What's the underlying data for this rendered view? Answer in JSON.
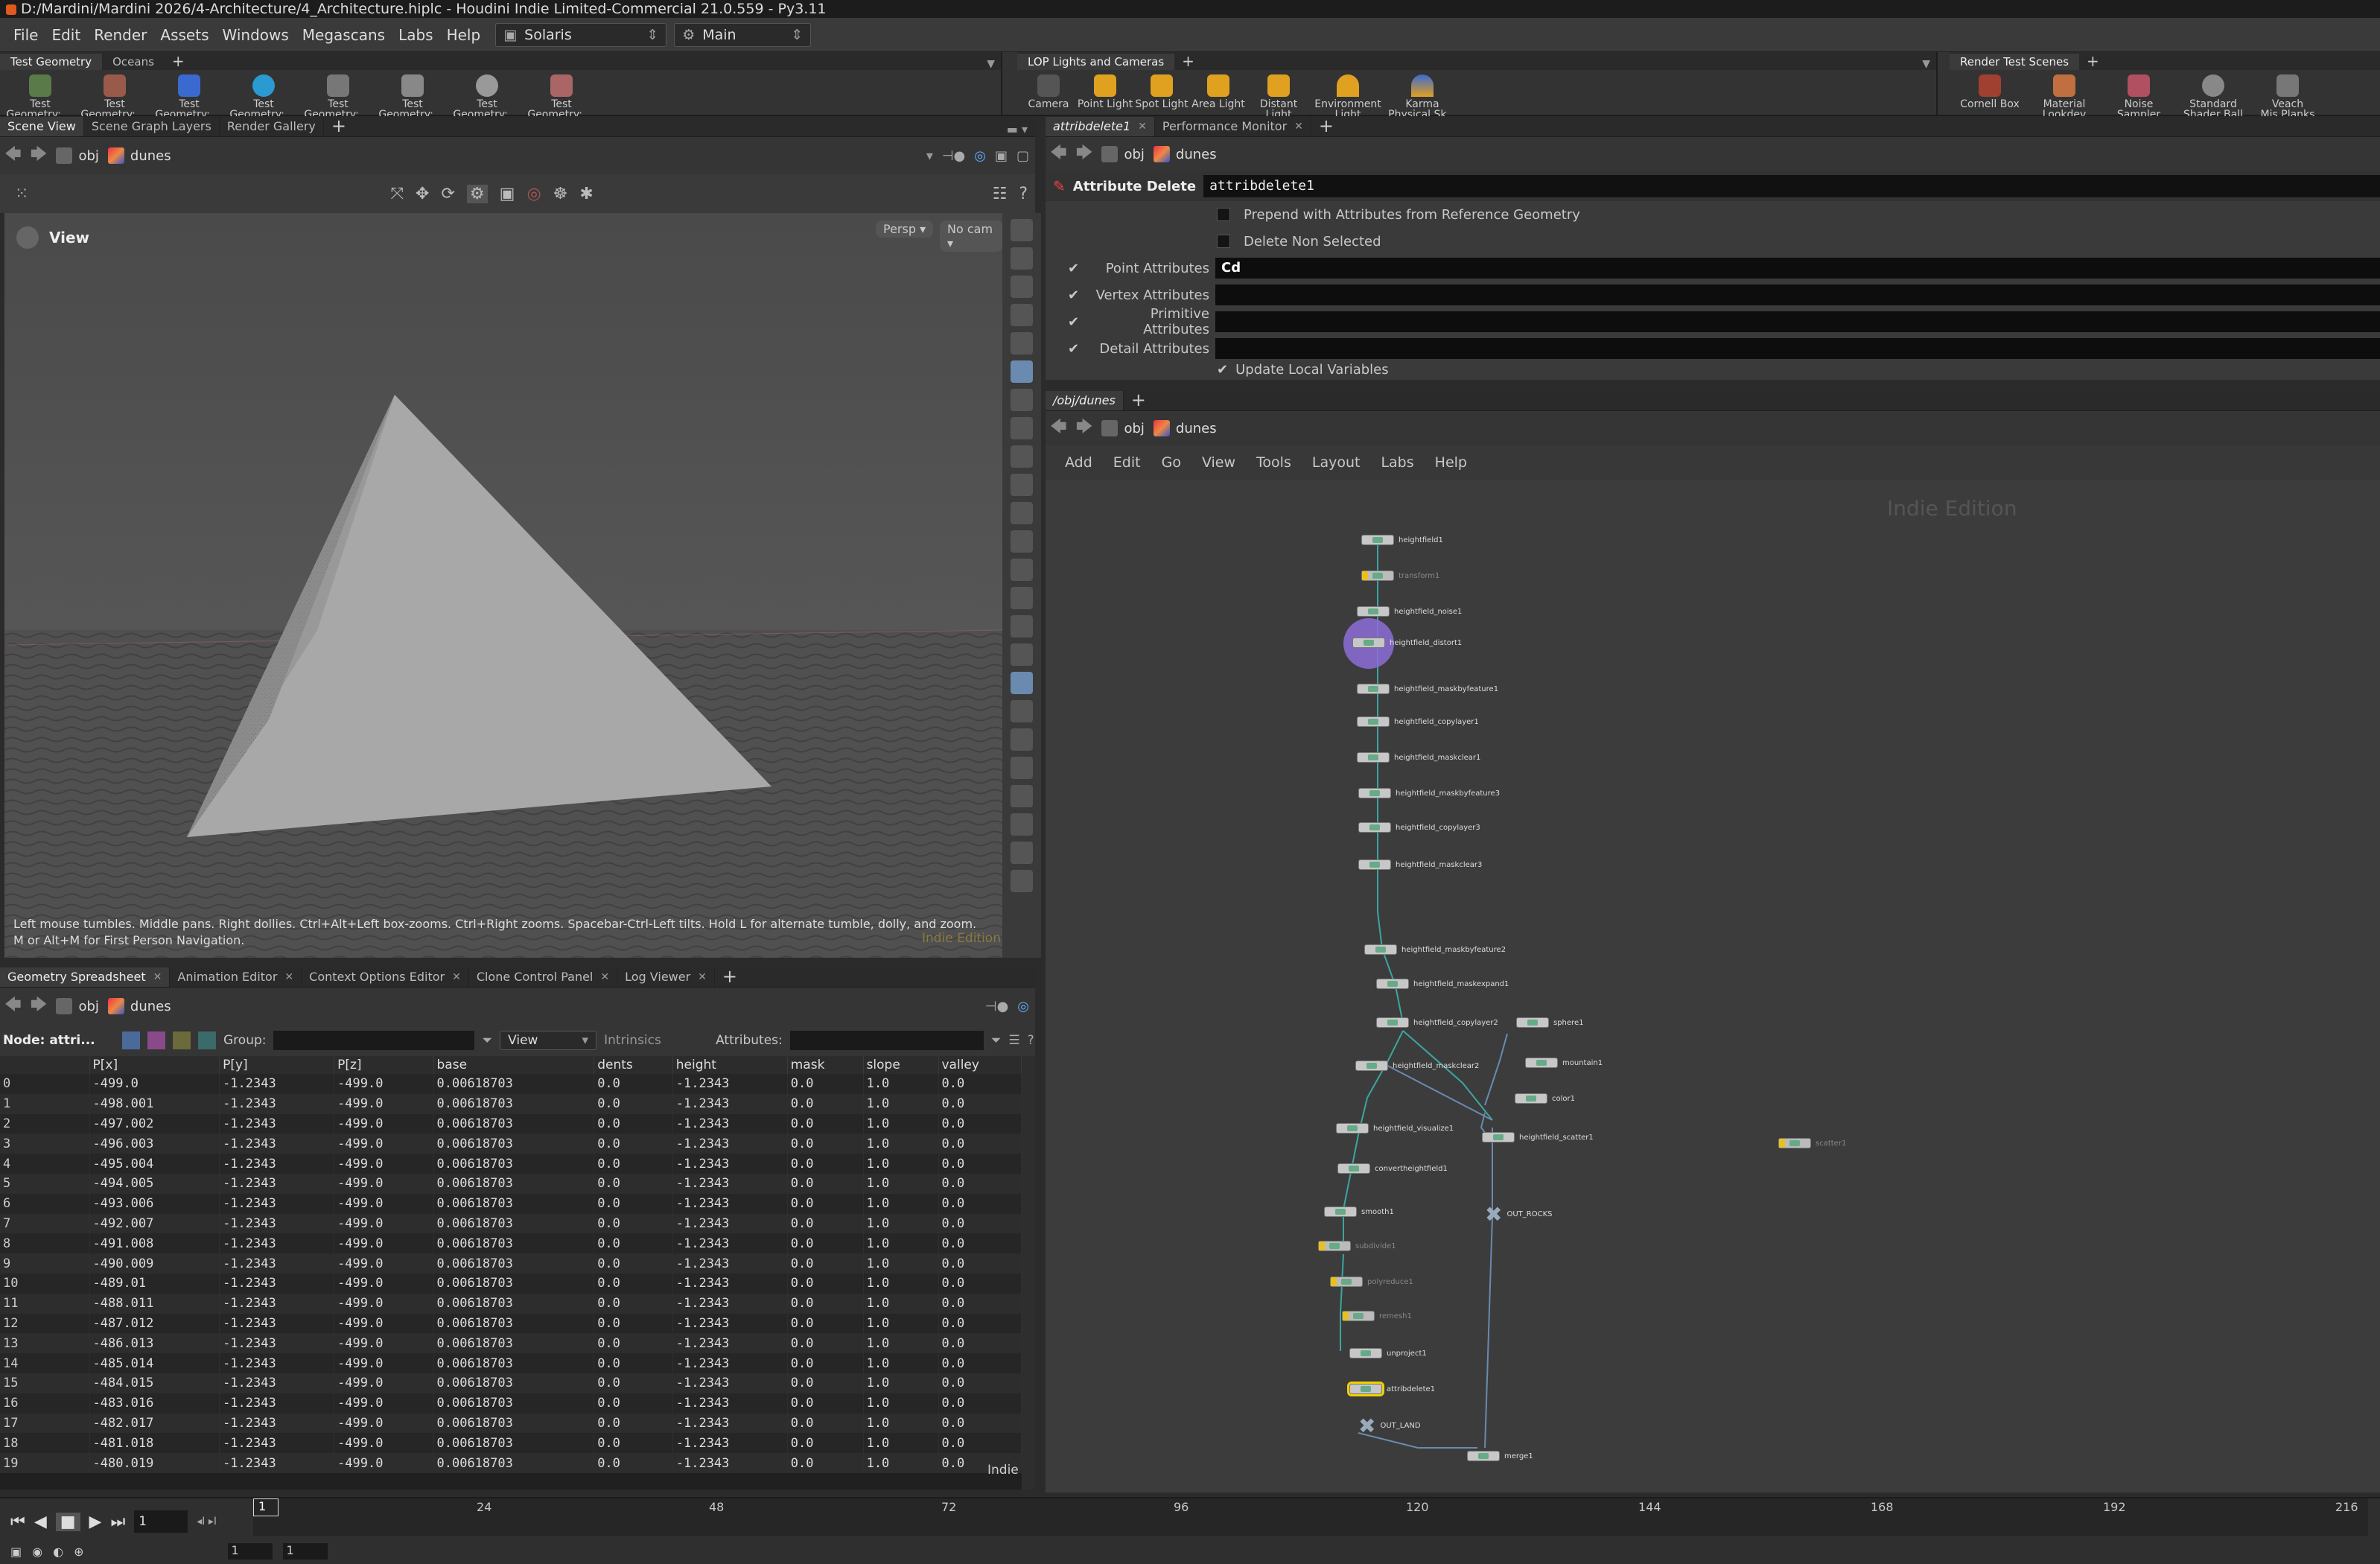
{
  "titlebar": {
    "title": "D:/Mardini/Mardini 2026/4-Architecture/4_Architecture.hiplc - Houdini Indie Limited-Commercial 21.0.559 - Py3.11"
  },
  "menu": {
    "items": [
      "File",
      "Edit",
      "Render",
      "Assets",
      "Windows",
      "Megascans",
      "Labs",
      "Help"
    ],
    "desktop": "Solaris",
    "context": "Main"
  },
  "shelves": {
    "set1": {
      "tabs": [
        "Test Geometry",
        "Oceans"
      ],
      "tools": [
        "Test Geometry: ...",
        "Test Geometry: ...",
        "Test Geometry: ...",
        "Test Geometry: ...",
        "Test Geometry: ...",
        "Test Geometry: ...",
        "Test Geometry: ...",
        "Test Geometry: ..."
      ]
    },
    "set2": {
      "tabs": [
        "LOP Lights and Cameras"
      ],
      "tools": [
        {
          "l1": "Camera",
          "l2": ""
        },
        {
          "l1": "Point Light",
          "l2": ""
        },
        {
          "l1": "Spot Light",
          "l2": ""
        },
        {
          "l1": "Area Light",
          "l2": ""
        },
        {
          "l1": "Distant Light",
          "l2": ""
        },
        {
          "l1": "Environment",
          "l2": "Light"
        },
        {
          "l1": "Karma",
          "l2": "Physical Sk..."
        }
      ]
    },
    "set3": {
      "tabs": [
        "Render Test Scenes"
      ],
      "tools": [
        {
          "l1": "Cornell Box",
          "l2": ""
        },
        {
          "l1": "Material",
          "l2": "Lookdev"
        },
        {
          "l1": "Noise",
          "l2": "Sampler"
        },
        {
          "l1": "Standard",
          "l2": "Shader Ball"
        },
        {
          "l1": "Veach",
          "l2": "Mis Planks"
        }
      ]
    }
  },
  "scene_pane": {
    "tabs": [
      "Scene View",
      "Scene Graph Layers",
      "Render Gallery"
    ],
    "path": {
      "obj": "obj",
      "node": "dunes"
    },
    "view_label": "View",
    "persp": "Persp ▾",
    "cam": "No cam ▾",
    "help": "Left mouse tumbles. Middle pans. Right dollies. Ctrl+Alt+Left box-zooms. Ctrl+Right zooms. Spacebar-Ctrl-Left tilts. Hold L for alternate tumble, dolly, and zoom. M or Alt+M for First Person Navigation.",
    "watermark": "Indie Edition"
  },
  "spreadsheet": {
    "tabs": [
      "Geometry Spreadsheet",
      "Animation Editor",
      "Context Options Editor",
      "Clone Control Panel",
      "Log Viewer"
    ],
    "path": {
      "obj": "obj",
      "node": "dunes"
    },
    "node_label": "Node: attri...",
    "group_label": "Group:",
    "view_label": "View",
    "intrinsics": "Intrinsics",
    "attributes_label": "Attributes:",
    "columns": [
      "",
      "P[x]",
      "P[y]",
      "P[z]",
      "base",
      "dents",
      "height",
      "mask",
      "slope",
      "valley"
    ],
    "rows": [
      [
        "0",
        "-499.0",
        "-1.2343",
        "-499.0",
        "0.00618703",
        "0.0",
        "-1.2343",
        "0.0",
        "1.0",
        "0.0"
      ],
      [
        "1",
        "-498.001",
        "-1.2343",
        "-499.0",
        "0.00618703",
        "0.0",
        "-1.2343",
        "0.0",
        "1.0",
        "0.0"
      ],
      [
        "2",
        "-497.002",
        "-1.2343",
        "-499.0",
        "0.00618703",
        "0.0",
        "-1.2343",
        "0.0",
        "1.0",
        "0.0"
      ],
      [
        "3",
        "-496.003",
        "-1.2343",
        "-499.0",
        "0.00618703",
        "0.0",
        "-1.2343",
        "0.0",
        "1.0",
        "0.0"
      ],
      [
        "4",
        "-495.004",
        "-1.2343",
        "-499.0",
        "0.00618703",
        "0.0",
        "-1.2343",
        "0.0",
        "1.0",
        "0.0"
      ],
      [
        "5",
        "-494.005",
        "-1.2343",
        "-499.0",
        "0.00618703",
        "0.0",
        "-1.2343",
        "0.0",
        "1.0",
        "0.0"
      ],
      [
        "6",
        "-493.006",
        "-1.2343",
        "-499.0",
        "0.00618703",
        "0.0",
        "-1.2343",
        "0.0",
        "1.0",
        "0.0"
      ],
      [
        "7",
        "-492.007",
        "-1.2343",
        "-499.0",
        "0.00618703",
        "0.0",
        "-1.2343",
        "0.0",
        "1.0",
        "0.0"
      ],
      [
        "8",
        "-491.008",
        "-1.2343",
        "-499.0",
        "0.00618703",
        "0.0",
        "-1.2343",
        "0.0",
        "1.0",
        "0.0"
      ],
      [
        "9",
        "-490.009",
        "-1.2343",
        "-499.0",
        "0.00618703",
        "0.0",
        "-1.2343",
        "0.0",
        "1.0",
        "0.0"
      ],
      [
        "10",
        "-489.01",
        "-1.2343",
        "-499.0",
        "0.00618703",
        "0.0",
        "-1.2343",
        "0.0",
        "1.0",
        "0.0"
      ],
      [
        "11",
        "-488.011",
        "-1.2343",
        "-499.0",
        "0.00618703",
        "0.0",
        "-1.2343",
        "0.0",
        "1.0",
        "0.0"
      ],
      [
        "12",
        "-487.012",
        "-1.2343",
        "-499.0",
        "0.00618703",
        "0.0",
        "-1.2343",
        "0.0",
        "1.0",
        "0.0"
      ],
      [
        "13",
        "-486.013",
        "-1.2343",
        "-499.0",
        "0.00618703",
        "0.0",
        "-1.2343",
        "0.0",
        "1.0",
        "0.0"
      ],
      [
        "14",
        "-485.014",
        "-1.2343",
        "-499.0",
        "0.00618703",
        "0.0",
        "-1.2343",
        "0.0",
        "1.0",
        "0.0"
      ],
      [
        "15",
        "-484.015",
        "-1.2343",
        "-499.0",
        "0.00618703",
        "0.0",
        "-1.2343",
        "0.0",
        "1.0",
        "0.0"
      ],
      [
        "16",
        "-483.016",
        "-1.2343",
        "-499.0",
        "0.00618703",
        "0.0",
        "-1.2343",
        "0.0",
        "1.0",
        "0.0"
      ],
      [
        "17",
        "-482.017",
        "-1.2343",
        "-499.0",
        "0.00618703",
        "0.0",
        "-1.2343",
        "0.0",
        "1.0",
        "0.0"
      ],
      [
        "18",
        "-481.018",
        "-1.2343",
        "-499.0",
        "0.00618703",
        "0.0",
        "-1.2343",
        "0.0",
        "1.0",
        "0.0"
      ],
      [
        "19",
        "-480.019",
        "-1.2343",
        "-499.0",
        "0.00618703",
        "0.0",
        "-1.2343",
        "0.0",
        "1.0",
        "0.0"
      ]
    ],
    "indie": "Indie"
  },
  "params_pane": {
    "tabs": [
      "attribdelete1",
      "Performance Monitor"
    ],
    "path": {
      "obj": "obj",
      "node": "dunes"
    },
    "node_type": "Attribute Delete",
    "node_name": "attribdelete1",
    "prepend": "Prepend with Attributes from Reference Geometry",
    "delete_non_selected": "Delete Non Selected",
    "fields": [
      {
        "label": "Point Attributes",
        "value": "Cd"
      },
      {
        "label": "Vertex Attributes",
        "value": ""
      },
      {
        "label": "Primitive Attributes",
        "value": ""
      },
      {
        "label": "Detail Attributes",
        "value": ""
      }
    ],
    "update_local": "Update Local Variables"
  },
  "network_pane": {
    "tabs": [
      "/obj/dunes"
    ],
    "path": {
      "obj": "obj",
      "node": "dunes"
    },
    "menu": [
      "Add",
      "Edit",
      "Go",
      "View",
      "Tools",
      "Layout",
      "Labs",
      "Help"
    ],
    "watermark": "Indie Edition",
    "nodes": [
      "heightfield1",
      "transform1",
      "heightfield_noise1",
      "heightfield_distort1",
      "heightfield_maskbyfeature1",
      "heightfield_copylayer1",
      "heightfield_maskclear1",
      "heightfield_maskbyfeature3",
      "heightfield_copylayer3",
      "heightfield_maskclear3",
      "heightfield_maskbyfeature2",
      "heightfield_maskexpand1",
      "heightfield_copylayer2",
      "sphere1",
      "mountain1",
      "heightfield_maskclear2",
      "color1",
      "heightfield_visualize1",
      "heightfield_scatter1",
      "convertheightfield1",
      "OUT_ROCKS",
      "smooth1",
      "subdivide1",
      "polyreduce1",
      "remesh1",
      "unproject1",
      "attribdelete1",
      "OUT_LAND",
      "merge1",
      "scatter1"
    ]
  },
  "timeline": {
    "frame": "1",
    "ticks": [
      "24",
      "48",
      "72",
      "96",
      "120",
      "144",
      "168",
      "192",
      "216"
    ],
    "start": "1",
    "end": "1"
  },
  "colors": {
    "accent": "#f0d000",
    "selected_node": "#8c6cd8",
    "wire": "#3aa6a0"
  }
}
